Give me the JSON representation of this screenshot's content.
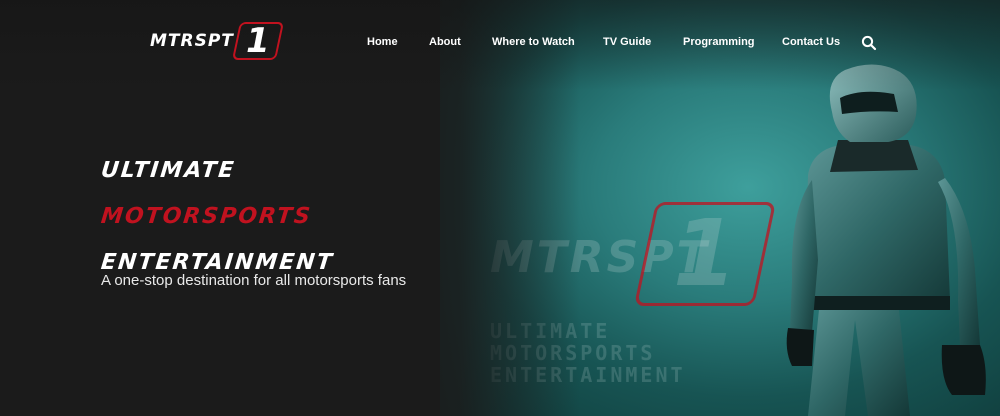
{
  "brand": {
    "logo_text": "MTRSPT",
    "logo_number": "1",
    "accent_color": "#c1121f"
  },
  "nav": {
    "items": [
      {
        "label": "Home"
      },
      {
        "label": "About"
      },
      {
        "label": "Where to Watch"
      },
      {
        "label": "TV Guide"
      },
      {
        "label": "Programming"
      },
      {
        "label": "Contact Us"
      }
    ],
    "search_icon": "search-icon"
  },
  "hero": {
    "headline": {
      "line1": "ULTIMATE",
      "line2": "MOTORSPORTS",
      "line3": "ENTERTAINMENT"
    },
    "tagline": "A one-stop destination for all motorsports fans"
  },
  "background": {
    "watermark_text": "MTRSPT",
    "watermark_number": "1",
    "watermark_sub": [
      "ULTIMATE",
      "MOTORSPORTS",
      "ENTERTAINMENT"
    ]
  }
}
